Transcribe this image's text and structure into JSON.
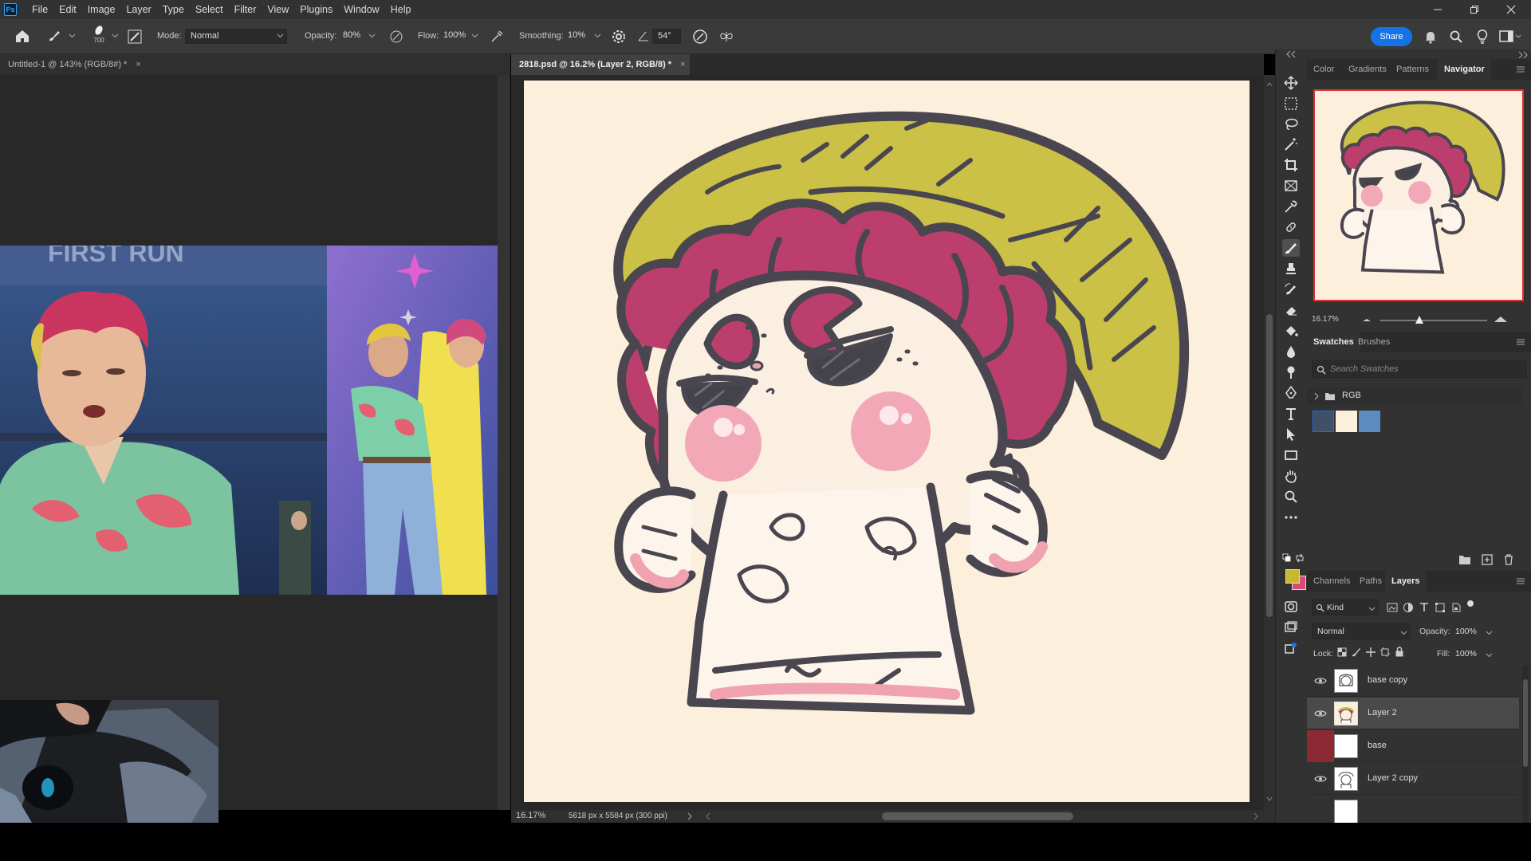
{
  "app": {
    "logo": "Ps",
    "menu": [
      "File",
      "Edit",
      "Image",
      "Layer",
      "Type",
      "Select",
      "Filter",
      "View",
      "Plugins",
      "Window",
      "Help"
    ]
  },
  "options": {
    "brush_size": "700",
    "mode_label": "Mode:",
    "mode_value": "Normal",
    "opacity_label": "Opacity:",
    "opacity_value": "80%",
    "flow_label": "Flow:",
    "flow_value": "100%",
    "smoothing_label": "Smoothing:",
    "smoothing_value": "10%",
    "angle_value": "54°",
    "share_label": "Share"
  },
  "tabs": [
    {
      "label": "Untitled-1 @ 143% (RGB/8#) *",
      "close": "×"
    },
    {
      "label": "2818.psd @ 16.2% (Layer 2, RGB/8) *",
      "close": "×"
    }
  ],
  "status": {
    "zoom": "16.17%",
    "doc_info": "5618 px x 5584 px (300 ppi)"
  },
  "ref_image": {
    "banner_text": "FIRST RUN"
  },
  "navigator": {
    "tabs": [
      "Color",
      "Gradients",
      "Patterns",
      "Navigator"
    ],
    "active_tab": "Navigator",
    "zoom": "16.17%"
  },
  "swatches": {
    "tabs": [
      "Swatches",
      "Brushes"
    ],
    "search_placeholder": "Search Swatches",
    "group_name": "RGB",
    "colors": [
      "#3f5068",
      "#fcefdc",
      "#5b8cbf"
    ]
  },
  "layers": {
    "tabs": [
      "Channels",
      "Paths",
      "Layers"
    ],
    "filter_kind": "Kind",
    "blend_mode": "Normal",
    "opacity_label": "Opacity:",
    "opacity_value": "100%",
    "lock_label": "Lock:",
    "fill_label": "Fill:",
    "fill_value": "100%",
    "items": [
      {
        "name": "base copy",
        "visible": true,
        "selected": false
      },
      {
        "name": "Layer 2",
        "visible": true,
        "selected": true
      },
      {
        "name": "base",
        "visible": false,
        "selected": false
      },
      {
        "name": "Layer 2 copy",
        "visible": true,
        "selected": false
      }
    ]
  },
  "colors": {
    "foreground": "#c8b830",
    "background": "#d84a7a",
    "accent": "#1473e6"
  }
}
